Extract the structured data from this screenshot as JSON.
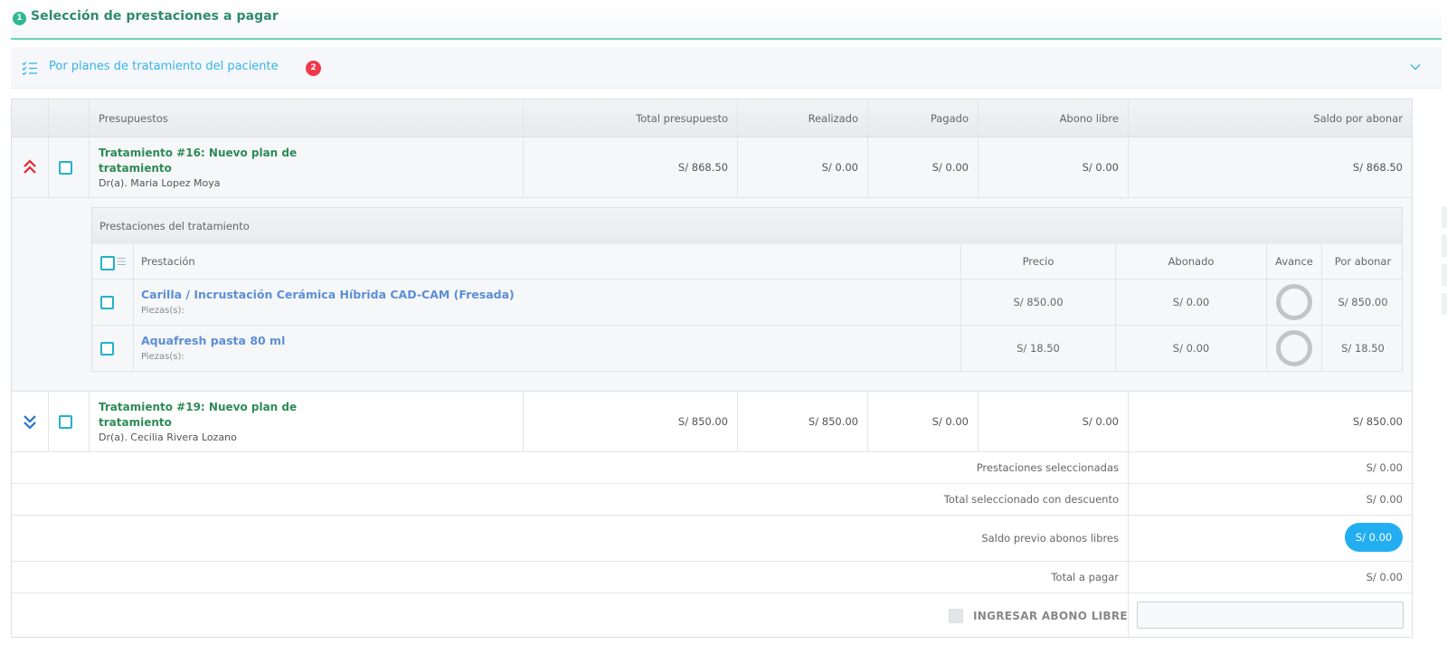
{
  "header": {
    "step": "1",
    "title": "Selección de prestaciones a pagar"
  },
  "accordion": {
    "icon": "checklist-icon",
    "label": "Por planes de tratamiento del paciente",
    "badge": "2"
  },
  "table": {
    "headers": [
      "Presupuestos",
      "Total presupuesto",
      "Realizado",
      "Pagado",
      "Abono libre",
      "Saldo por abonar"
    ],
    "treatments": [
      {
        "title": "Tratamiento #16: Nuevo plan de tratamiento",
        "doctor": "Dr(a). Maria Lopez Moya",
        "total": "S/ 868.50",
        "realizado": "S/ 0.00",
        "pagado": "S/ 0.00",
        "abono": "S/ 0.00",
        "saldo": "S/ 868.50",
        "expanded": true,
        "toggle_icon": "double-chevron-up-icon",
        "toggle_color": "#e8252e"
      },
      {
        "title": "Tratamiento #19: Nuevo plan de tratamiento",
        "doctor": "Dr(a). Cecilia Rivera Lozano",
        "total": "S/ 850.00",
        "realizado": "S/ 850.00",
        "pagado": "S/ 0.00",
        "abono": "S/ 0.00",
        "saldo": "S/ 850.00",
        "expanded": false,
        "toggle_icon": "double-chevron-down-icon",
        "toggle_color": "#2672c9"
      }
    ],
    "sub_table": {
      "title": "Prestaciones del tratamiento",
      "headers": [
        "Prestación",
        "Precio",
        "Abonado",
        "Avance",
        "Por abonar"
      ],
      "rows": [
        {
          "name": "Carilla / Incrustación Cerámica Híbrida CAD-CAM (Fresada)",
          "piezas": "Piezas(s):",
          "precio": "S/ 850.00",
          "abonado": "S/ 0.00",
          "avance": 0,
          "por_abonar": "S/ 850.00"
        },
        {
          "name": "Aquafresh pasta 80 ml",
          "piezas": "Piezas(s):",
          "precio": "S/ 18.50",
          "abonado": "S/ 0.00",
          "avance": 0,
          "por_abonar": "S/ 18.50"
        }
      ]
    },
    "summary": [
      {
        "label": "Prestaciones seleccionadas",
        "value": "S/ 0.00"
      },
      {
        "label": "Total seleccionado con descuento",
        "value": "S/ 0.00"
      },
      {
        "label": "Saldo previo abonos libres",
        "value": "S/ 0.00"
      },
      {
        "label": "Total a pagar",
        "value": "S/ 0.00"
      }
    ],
    "abono_libre": {
      "label": "INGRESAR ABONO LIBRE",
      "value": ""
    }
  },
  "colors": {
    "accent_green": "#2e8b57",
    "link_blue": "#5b8fd6",
    "pill_blue": "#23aef2",
    "badge_red": "#f0394b"
  }
}
